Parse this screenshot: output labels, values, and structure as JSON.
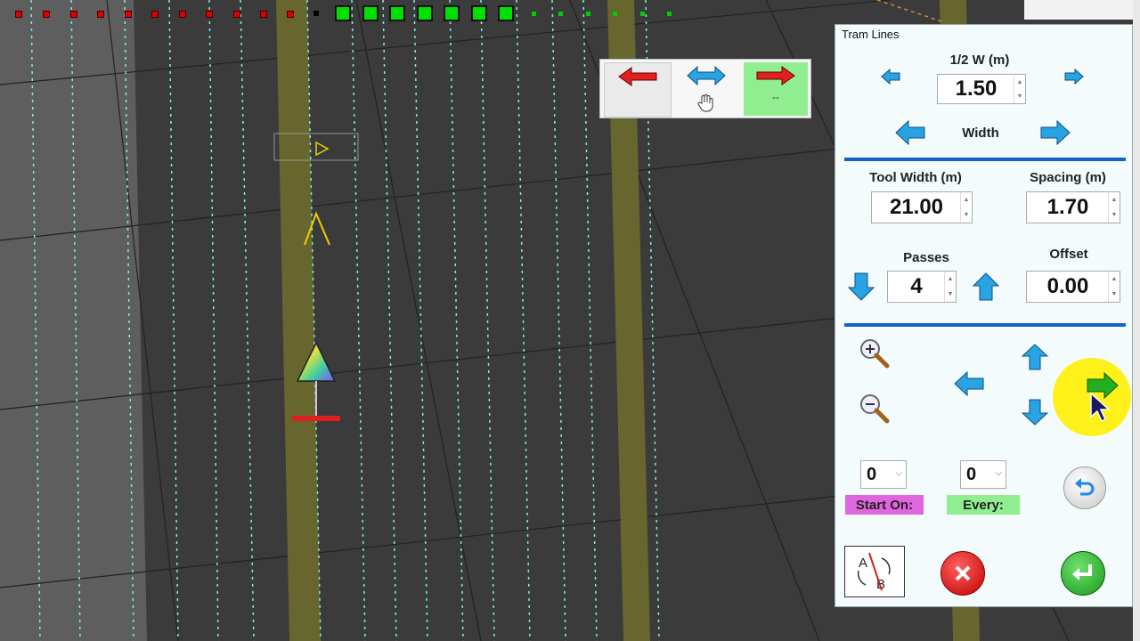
{
  "panel": {
    "title": "Tram Lines",
    "half_width": {
      "label": "1/2 W (m)",
      "value": "1.50"
    },
    "width_label": "Width",
    "tool_width": {
      "label": "Tool Width (m)",
      "value": "21.00"
    },
    "spacing": {
      "label": "Spacing (m)",
      "value": "1.70"
    },
    "passes": {
      "label": "Passes",
      "value": "4"
    },
    "offset": {
      "label": "Offset",
      "value": "0.00"
    },
    "start_on": {
      "label": "Start On:",
      "value": "0"
    },
    "every": {
      "label": "Every:",
      "value": "0"
    },
    "ab_label_a": "A",
    "ab_label_b": "B"
  },
  "nudge": {
    "center_value": "--"
  },
  "colors": {
    "start_on_bg": "#e066e0",
    "every_bg": "#90ee90",
    "separator": "#1565c0",
    "arrow_blue": "#29a3e3",
    "tram_green": "#00e000"
  },
  "icons": [
    "left-arrow-icon",
    "right-arrow-icon",
    "up-arrow-icon",
    "down-arrow-icon",
    "zoom-in-icon",
    "zoom-out-icon",
    "undo-icon",
    "cancel-icon",
    "enter-icon",
    "swap-icon",
    "hand-icon"
  ]
}
